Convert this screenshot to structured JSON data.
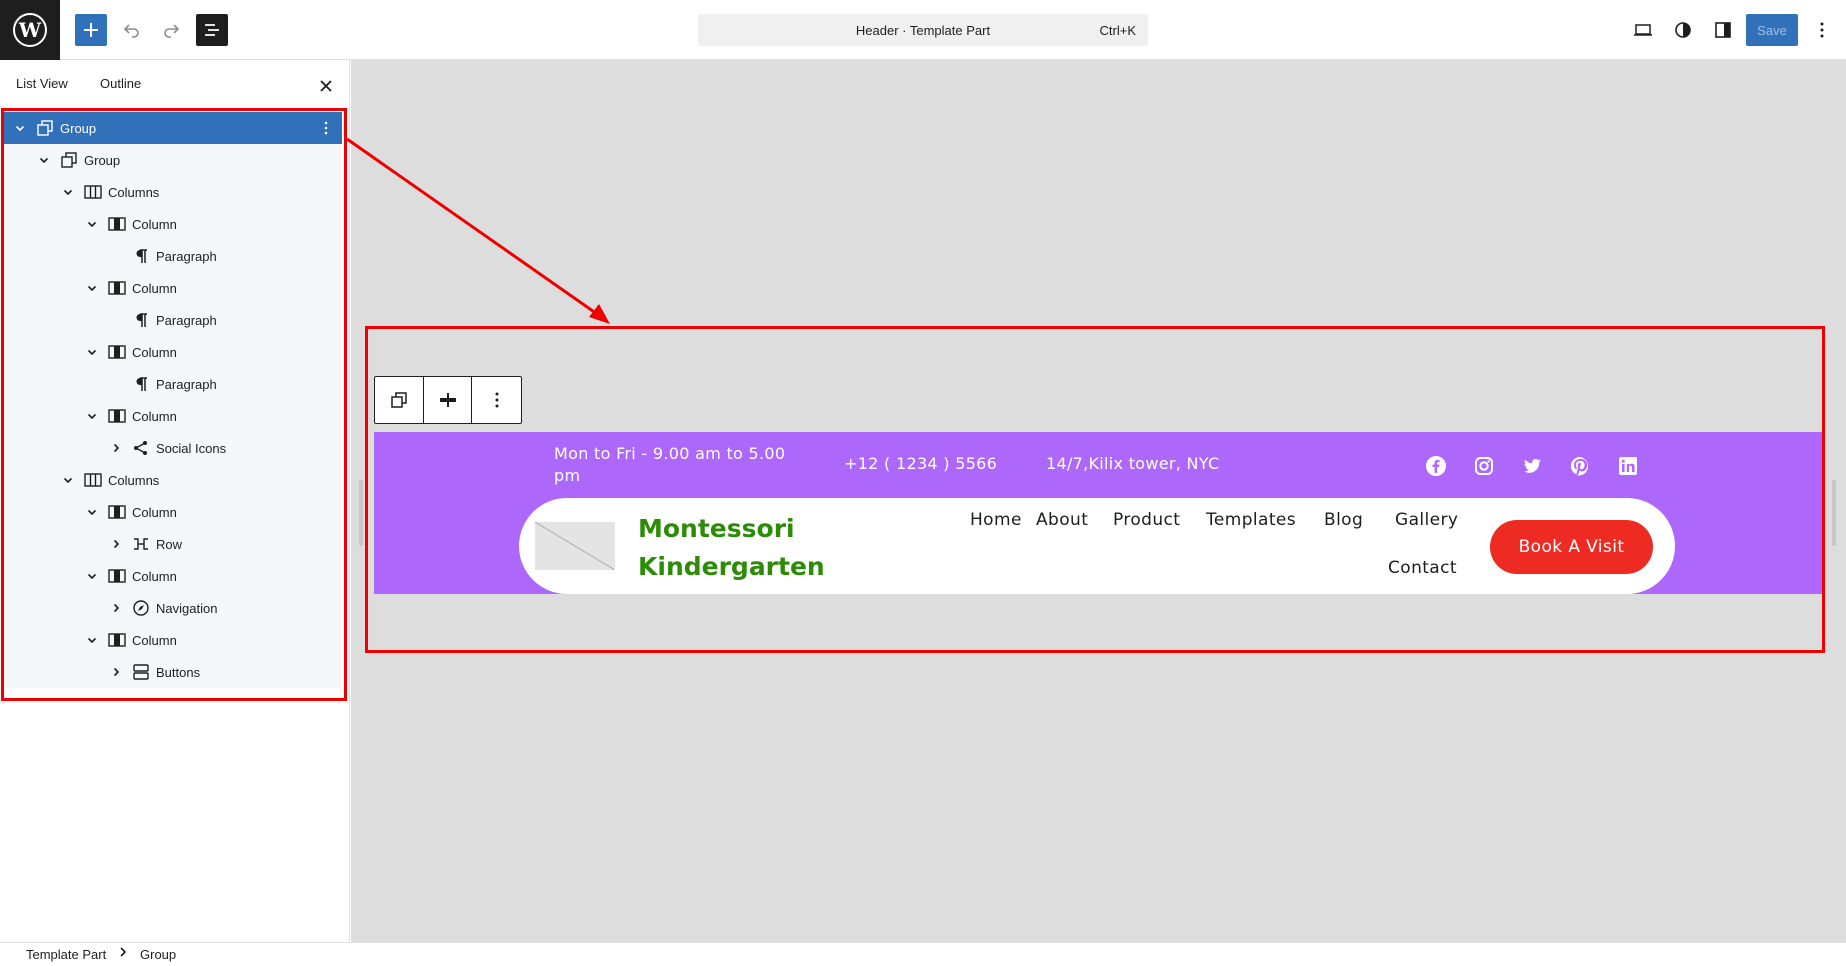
{
  "topbar": {
    "command_title": "Header · Template Part",
    "command_shortcut": "Ctrl+K",
    "save_label": "Save",
    "icons": [
      "wordpress-logo-icon",
      "plus-icon",
      "undo-icon",
      "redo-icon",
      "list-view-icon",
      "desktop-preview-icon",
      "styles-contrast-icon",
      "settings-panel-icon",
      "more-vertical-icon"
    ]
  },
  "sidebar": {
    "tab_list_view": "List View",
    "tab_outline": "Outline",
    "tree": [
      {
        "label": "Group",
        "expanded": true,
        "selected": true,
        "icon": "group-icon"
      },
      {
        "label": "Group",
        "expanded": true,
        "icon": "group-icon"
      },
      {
        "label": "Columns",
        "expanded": true,
        "icon": "columns-icon"
      },
      {
        "label": "Column",
        "expanded": true,
        "icon": "column-icon"
      },
      {
        "label": "Paragraph",
        "icon": "paragraph-icon"
      },
      {
        "label": "Column",
        "expanded": true,
        "icon": "column-icon"
      },
      {
        "label": "Paragraph",
        "icon": "paragraph-icon"
      },
      {
        "label": "Column",
        "expanded": true,
        "icon": "column-icon"
      },
      {
        "label": "Paragraph",
        "icon": "paragraph-icon"
      },
      {
        "label": "Column",
        "expanded": true,
        "icon": "column-icon"
      },
      {
        "label": "Social Icons",
        "expanded": false,
        "icon": "share-icon"
      },
      {
        "label": "Columns",
        "expanded": true,
        "icon": "columns-icon"
      },
      {
        "label": "Column",
        "expanded": true,
        "icon": "column-icon"
      },
      {
        "label": "Row",
        "expanded": false,
        "icon": "row-icon"
      },
      {
        "label": "Column",
        "expanded": true,
        "icon": "column-icon"
      },
      {
        "label": "Navigation",
        "expanded": false,
        "icon": "navigation-icon"
      },
      {
        "label": "Column",
        "expanded": true,
        "icon": "column-icon"
      },
      {
        "label": "Buttons",
        "expanded": false,
        "icon": "buttons-icon"
      }
    ]
  },
  "header_part": {
    "hours": "Mon to Fri - 9.00 am to 5.00 pm",
    "phone": "+12 ( 1234 ) 5566",
    "address": "14/7,Kilix tower, NYC",
    "social": [
      "facebook-icon",
      "instagram-icon",
      "twitter-icon",
      "pinterest-icon",
      "linkedin-icon"
    ],
    "site_title": "Montessori Kindergarten",
    "nav": [
      "Home",
      "About",
      "Product",
      "Templates",
      "Blog",
      "Gallery",
      "Contact"
    ],
    "button_label": "Book A Visit",
    "colors": {
      "band": "#ad67fa",
      "title": "#2d8c06",
      "button": "#ee2b22",
      "highlight": "#ee0000"
    }
  },
  "breadcrumb": {
    "items": [
      "Template Part",
      "Group"
    ]
  }
}
